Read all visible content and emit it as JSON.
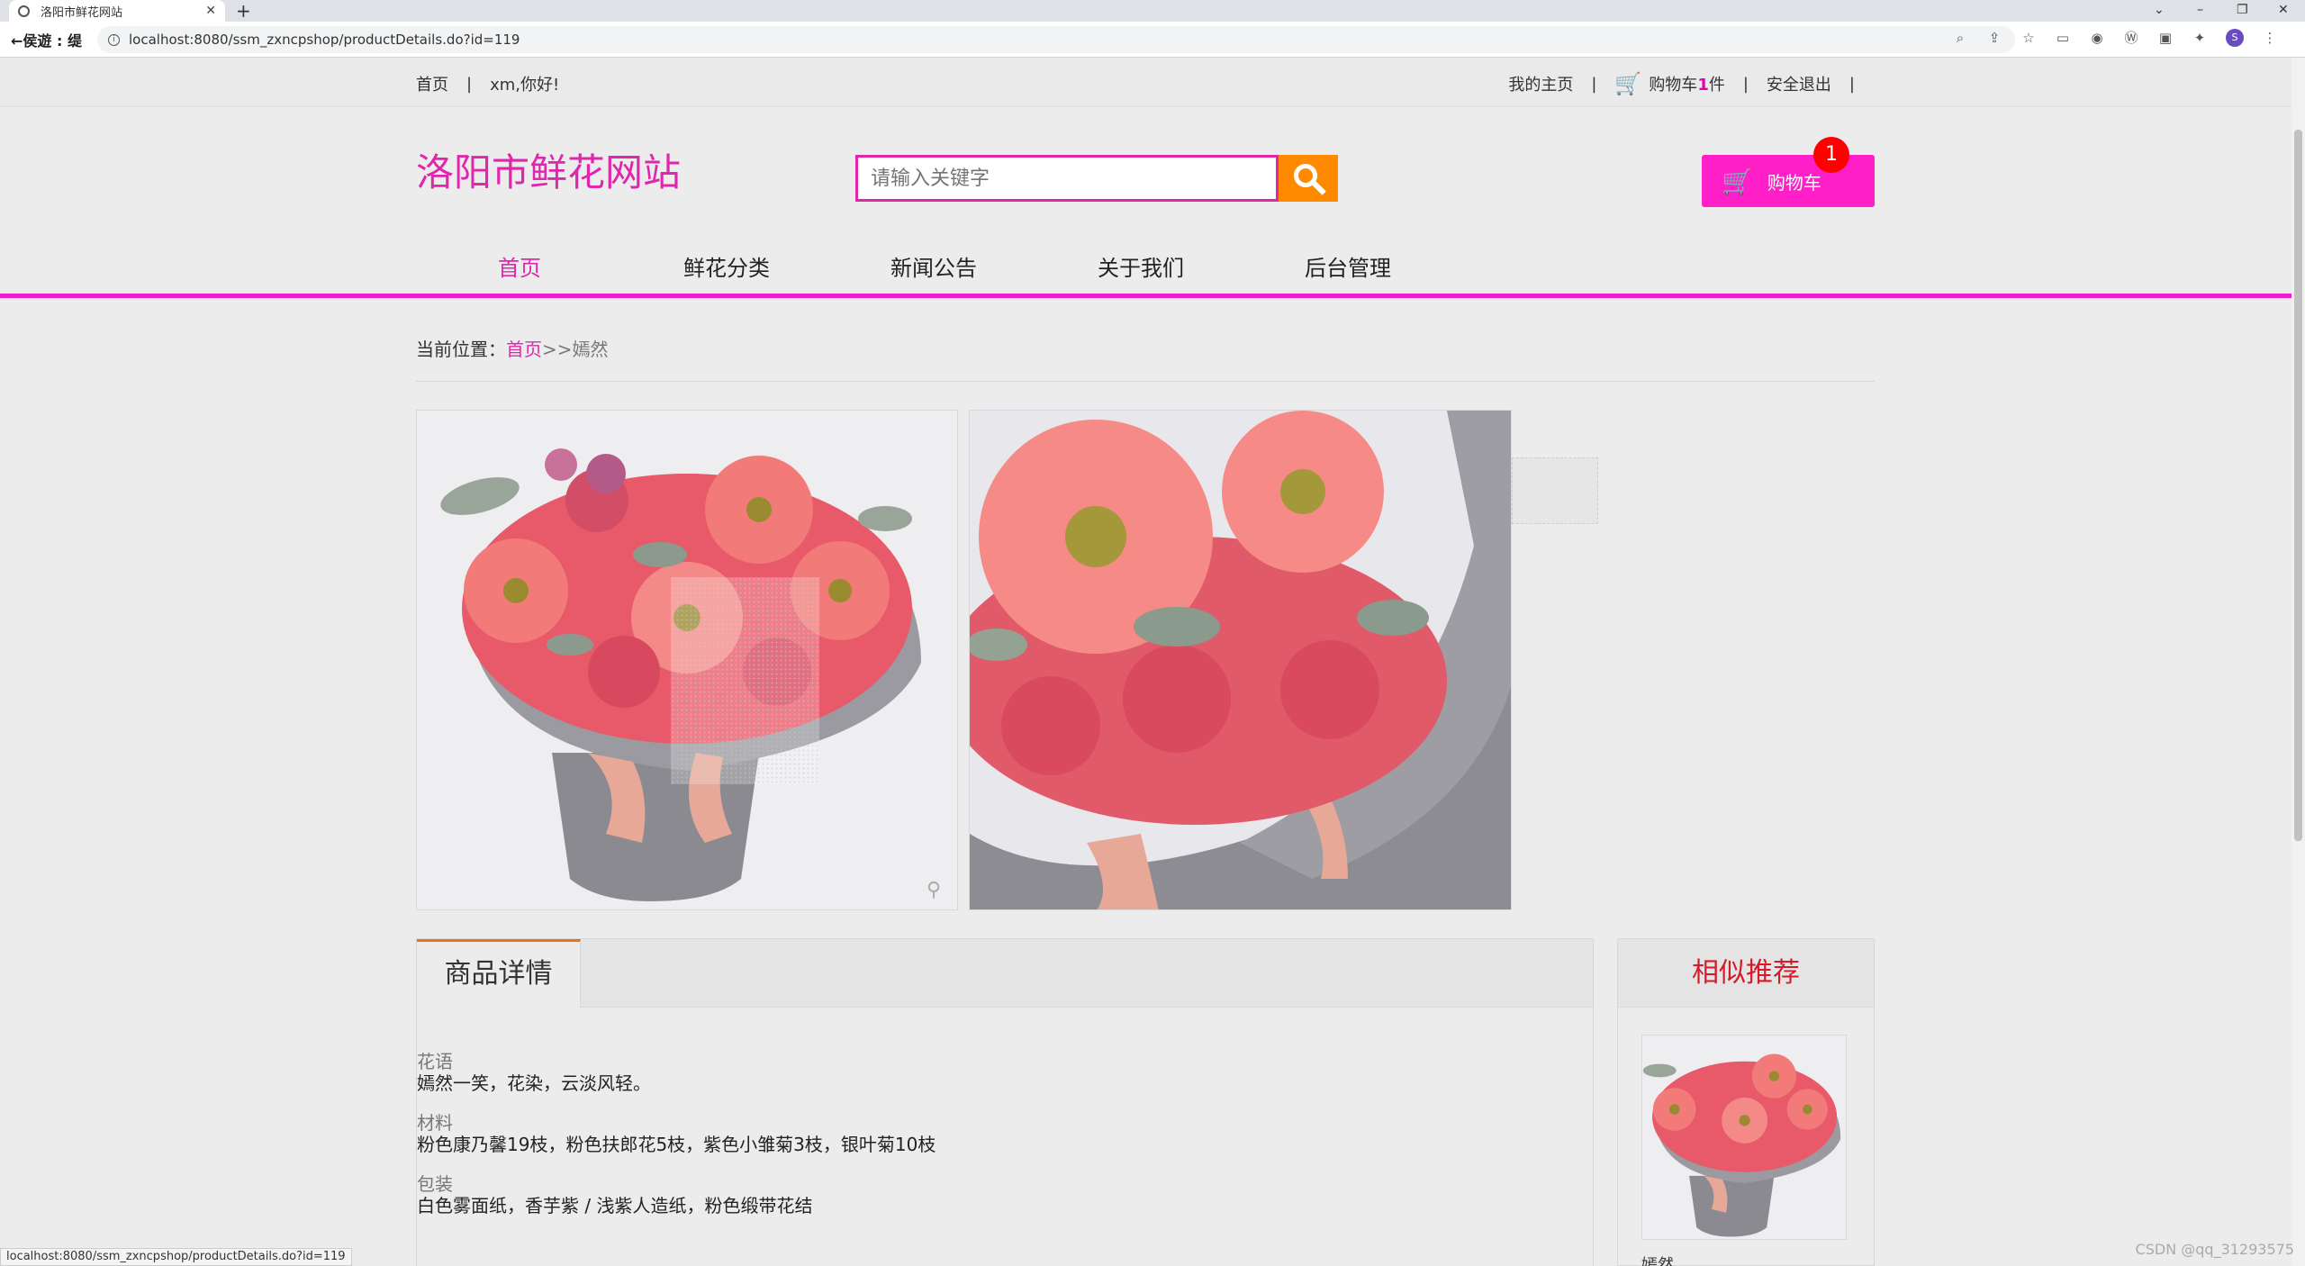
{
  "browser": {
    "tab_title": "洛阳市鲜花网站",
    "new_tab": "+",
    "back_label": "←侯遊 : 缇",
    "url": "localhost:8080/ssm_zxncpshop/productDetails.do?id=119",
    "status_url": "localhost:8080/ssm_zxncpshop/productDetails.do?id=119",
    "avatar_letter": "S"
  },
  "topbar": {
    "home": "首页",
    "greeting": "xm,你好!",
    "my_home": "我的主页",
    "cart_text": "购物车",
    "cart_count": "1",
    "cart_unit": "件",
    "logout": "安全退出"
  },
  "header": {
    "logo": "洛阳市鲜花网站",
    "search_placeholder": "请输入关键字",
    "cart_button": "购物车",
    "cart_badge": "1"
  },
  "nav": {
    "items": [
      "首页",
      "鲜花分类",
      "新闻公告",
      "关于我们",
      "后台管理"
    ]
  },
  "breadcrumb": {
    "prefix": "当前位置：",
    "home": "首页",
    "arrows": ">>",
    "current": "嫣然"
  },
  "detail": {
    "tab": "商品详情",
    "sections": [
      {
        "title": "花语",
        "text": "嫣然一笑，花染，云淡风轻。"
      },
      {
        "title": "材料",
        "text": "粉色康乃馨19枝，粉色扶郎花5枝，紫色小雏菊3枝，银叶菊10枝"
      },
      {
        "title": "包装",
        "text": "白色雾面纸，香芋紫 / 浅紫人造纸，粉色缎带花结"
      }
    ]
  },
  "recommend": {
    "title": "相似推荐",
    "item_name": "嫣然"
  },
  "watermark": "CSDN @qq_31293575",
  "colors": {
    "accent": "#e126ae",
    "nav_line": "#ee1ec8",
    "search_button": "#ff8a00",
    "cart_button": "#ff1fc8",
    "recommend_title": "#d51a2a"
  }
}
